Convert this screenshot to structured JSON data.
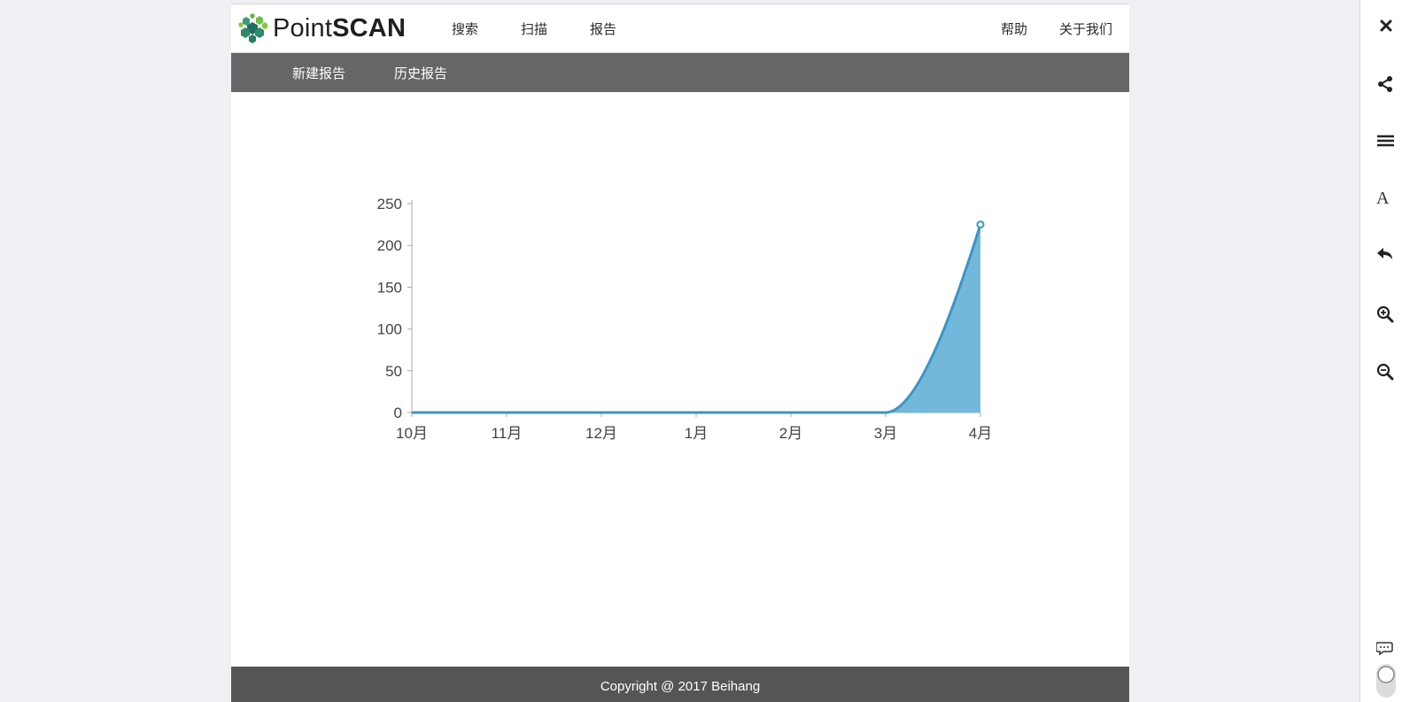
{
  "brand": {
    "name_light": "Point",
    "name_bold": "SCAN"
  },
  "nav": {
    "left": [
      "搜索",
      "扫描",
      "报告"
    ],
    "right": [
      "帮助",
      "关于我们"
    ]
  },
  "subnav": [
    "新建报告",
    "历史报告"
  ],
  "chart_data": {
    "type": "area",
    "categories": [
      "10月",
      "11月",
      "12月",
      "1月",
      "2月",
      "3月",
      "4月"
    ],
    "values": [
      0,
      0,
      0,
      0,
      0,
      0,
      225
    ],
    "ylim": [
      0,
      250
    ],
    "yticks": [
      0,
      50,
      100,
      150,
      200,
      250
    ],
    "line_color": "#3a96c4",
    "fill_color": "#72b8da",
    "grid": false,
    "title": "",
    "xlabel": "",
    "ylabel": ""
  },
  "footer": {
    "text": "Copyright @ 2017 Beihang"
  },
  "toolbar": {
    "icons": [
      "close-icon",
      "share-icon",
      "menu-icon",
      "font-icon",
      "back-icon",
      "zoom-in-icon",
      "zoom-out-icon",
      "comment-icon",
      "toggle-icon"
    ],
    "font_label": "A"
  },
  "colors": {
    "subnav_bg": "#666666",
    "footer_bg": "#555555",
    "page_bg": "#eef0f3"
  }
}
